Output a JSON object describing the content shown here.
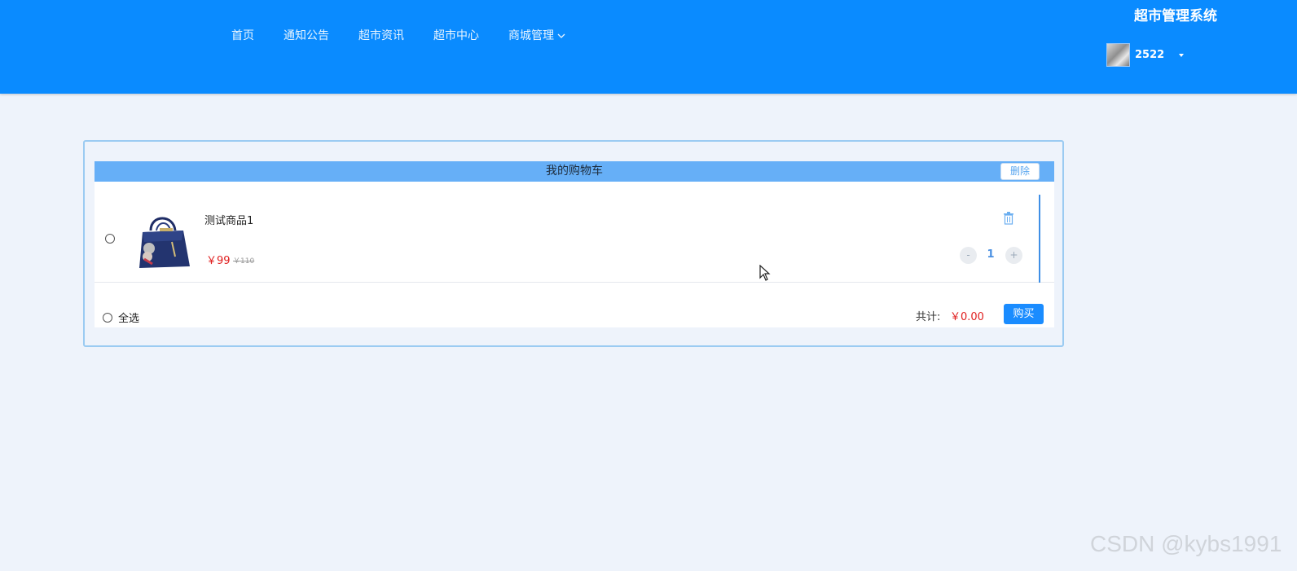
{
  "header": {
    "nav": [
      {
        "label": "首页"
      },
      {
        "label": "通知公告"
      },
      {
        "label": "超市资讯"
      },
      {
        "label": "超市中心"
      },
      {
        "label": "商城管理"
      }
    ],
    "system_title": "超市管理系统",
    "username": "2522"
  },
  "cart": {
    "title": "我的购物车",
    "delete_label": "删除",
    "items": [
      {
        "name": "测试商品1",
        "price": "￥99",
        "original_price": "￥110",
        "quantity": "1",
        "minus_label": "-",
        "plus_label": "+"
      }
    ],
    "select_all_label": "全选",
    "total_label": "共计:",
    "total_value": "￥0.00",
    "buy_label": "购买"
  },
  "colors": {
    "header_bg": "#0a8bff",
    "cart_header_bg": "#66aff7",
    "price": "#e02020",
    "button": "#1a8cff"
  },
  "icons": [
    "chevron-down-icon",
    "caret-down-icon",
    "trash-icon",
    "cursor-icon"
  ],
  "watermark": "CSDN @kybs1991"
}
